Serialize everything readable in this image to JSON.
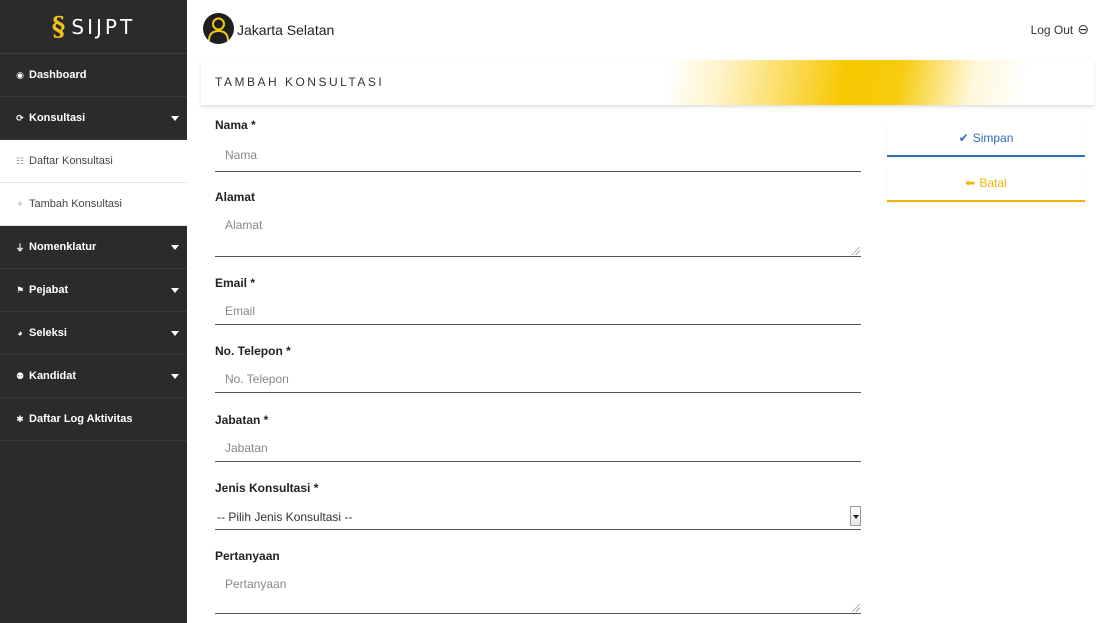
{
  "brand": {
    "logo": "§",
    "name": "SIJPT"
  },
  "sidebar": {
    "items": [
      {
        "icon": "◉",
        "label": "Dashboard",
        "type": "main"
      },
      {
        "icon": "⟳",
        "label": "Konsultasi",
        "type": "main",
        "expandable": true
      },
      {
        "icon": "☷",
        "label": "Daftar Konsultasi",
        "type": "sub"
      },
      {
        "icon": "+",
        "label": "Tambah Konsultasi",
        "type": "sub"
      },
      {
        "icon": "⏚",
        "label": "Nomenklatur",
        "type": "main",
        "expandable": true
      },
      {
        "icon": "⚑",
        "label": "Pejabat",
        "type": "main",
        "expandable": true
      },
      {
        "icon": "◕",
        "label": "Seleksi",
        "type": "main",
        "expandable": true
      },
      {
        "icon": "⚉",
        "label": "Kandidat",
        "type": "main",
        "expandable": true
      },
      {
        "icon": "✱",
        "label": "Daftar Log Aktivitas",
        "type": "main"
      }
    ]
  },
  "header": {
    "user_name": "Jakarta Selatan",
    "logout_label": "Log Out",
    "logout_icon": "⊖"
  },
  "page": {
    "title": "TAMBAH KONSULTASI"
  },
  "form": {
    "nama": {
      "label": "Nama *",
      "placeholder": "Nama"
    },
    "alamat": {
      "label": "Alamat",
      "placeholder": "Alamat"
    },
    "email": {
      "label": "Email *",
      "placeholder": "Email"
    },
    "telepon": {
      "label": "No. Telepon *",
      "placeholder": "No. Telepon"
    },
    "jabatan": {
      "label": "Jabatan *",
      "placeholder": "Jabatan"
    },
    "jenis": {
      "label": "Jenis Konsultasi *",
      "selected": "-- Pilih Jenis Konsultasi --"
    },
    "pertanyaan": {
      "label": "Pertanyaan",
      "placeholder": "Pertanyaan"
    }
  },
  "actions": {
    "save_icon": "✔",
    "save_label": "Simpan",
    "cancel_icon": "⬅",
    "cancel_label": "Batal"
  },
  "colors": {
    "sidebar_bg": "#2b2b2b",
    "accent_yellow": "#f7c700",
    "primary_blue": "#2f6fb7",
    "cancel_orange": "#f2b400"
  }
}
